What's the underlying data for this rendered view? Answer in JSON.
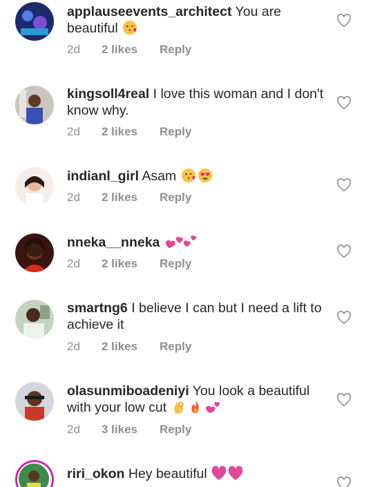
{
  "comments": [
    {
      "username": "applauseevents_architect",
      "text": " You are beautiful",
      "age": "2d",
      "likes": "2 likes",
      "reply": "Reply",
      "emojis": [
        "kiss-face"
      ],
      "avatar_color": "#3b4fa8"
    },
    {
      "username": "kingsoll4real",
      "text": " I love this woman and I don't know why.",
      "age": "2d",
      "likes": "2 likes",
      "reply": "Reply",
      "emojis": [],
      "avatar_color": "#c7c3bd"
    },
    {
      "username": "indianl_girl",
      "text": " Asam",
      "age": "2d",
      "likes": "2 likes",
      "reply": "Reply",
      "emojis": [
        "kiss-face",
        "heart-eyes"
      ],
      "avatar_color": "#f3ece8"
    },
    {
      "username": "nneka__nneka",
      "text": " ",
      "age": "2d",
      "likes": "2 likes",
      "reply": "Reply",
      "emojis": [
        "two-hearts"
      ],
      "avatar_color": "#7a1512"
    },
    {
      "username": "smartng6",
      "text": " I believe I can but I need a lift to achieve it",
      "age": "2d",
      "likes": "2 likes",
      "reply": "Reply",
      "emojis": [],
      "avatar_color": "#b9c9b4"
    },
    {
      "username": "olasunmiboadeniyi",
      "text": " You look a beautiful with your low cut",
      "age": "2d",
      "likes": "3 likes",
      "reply": "Reply",
      "emojis": [
        "ok-hand",
        "fire",
        "two-hearts"
      ],
      "avatar_color": "#cfd2d8"
    },
    {
      "username": "riri_okon",
      "text": " Hey beautiful ",
      "age": "",
      "likes": "",
      "reply": "",
      "emojis": [
        "heart",
        "heart"
      ],
      "avatar_color": "#2f6d3c"
    }
  ],
  "icons": {
    "like": "heart-outline-icon"
  }
}
